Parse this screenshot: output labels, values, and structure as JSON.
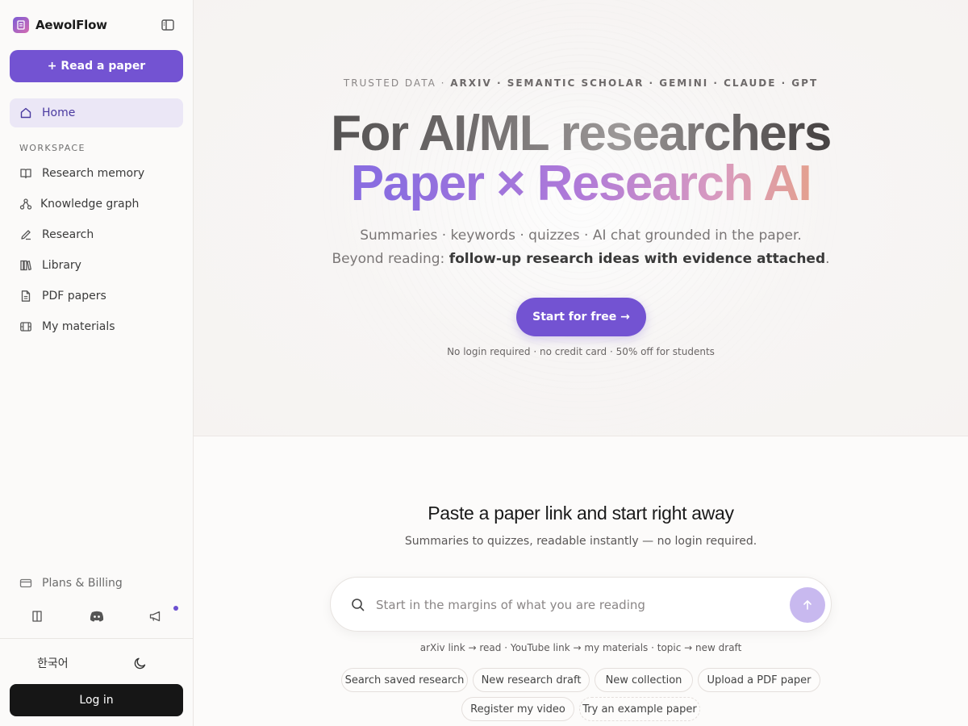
{
  "app": {
    "name": "AewolFlow"
  },
  "sidebar": {
    "read_button": "+ Read a paper",
    "home": "Home",
    "section_label": "WORKSPACE",
    "items": [
      {
        "label": "Research memory",
        "icon": "book-open-icon"
      },
      {
        "label": "Knowledge graph",
        "icon": "graph-icon"
      },
      {
        "label": "Research",
        "icon": "pen-icon"
      },
      {
        "label": "Library",
        "icon": "library-icon"
      },
      {
        "label": "PDF papers",
        "icon": "file-icon"
      },
      {
        "label": "My materials",
        "icon": "film-icon"
      }
    ],
    "plans": "Plans & Billing",
    "language": "한국어",
    "login": "Log in"
  },
  "hero": {
    "trusted_prefix": "TRUSTED DATA · ",
    "trusted_sources": "ARXIV · SEMANTIC SCHOLAR · GEMINI · CLAUDE · GPT",
    "headline_line1": "For AI/ML researchers",
    "headline_line2": "Paper × Research AI",
    "subtitle_line1": "Summaries · keywords · quizzes · AI chat grounded in the paper.",
    "subtitle_line2_prefix": "Beyond reading: ",
    "subtitle_line2_bold": "follow-up research ideas with evidence attached",
    "subtitle_line2_suffix": ".",
    "cta": "Start for free →",
    "cta_note": "No login required · no credit card · 50% off for students"
  },
  "quickstart": {
    "title": "Paste a paper link and start right away",
    "subtitle": "Summaries to quizzes, readable instantly — no login required.",
    "search_placeholder": "Start in the margins of what you are reading",
    "hint": "arXiv link → read · YouTube link → my materials · topic → new draft",
    "chips": [
      "Search saved research",
      "New research draft",
      "New collection",
      "Upload a PDF paper",
      "Register my video",
      "Try an example paper"
    ]
  },
  "colors": {
    "accent": "#7353d2",
    "active_bg": "#ebe7f6",
    "login_bg": "#161616"
  }
}
